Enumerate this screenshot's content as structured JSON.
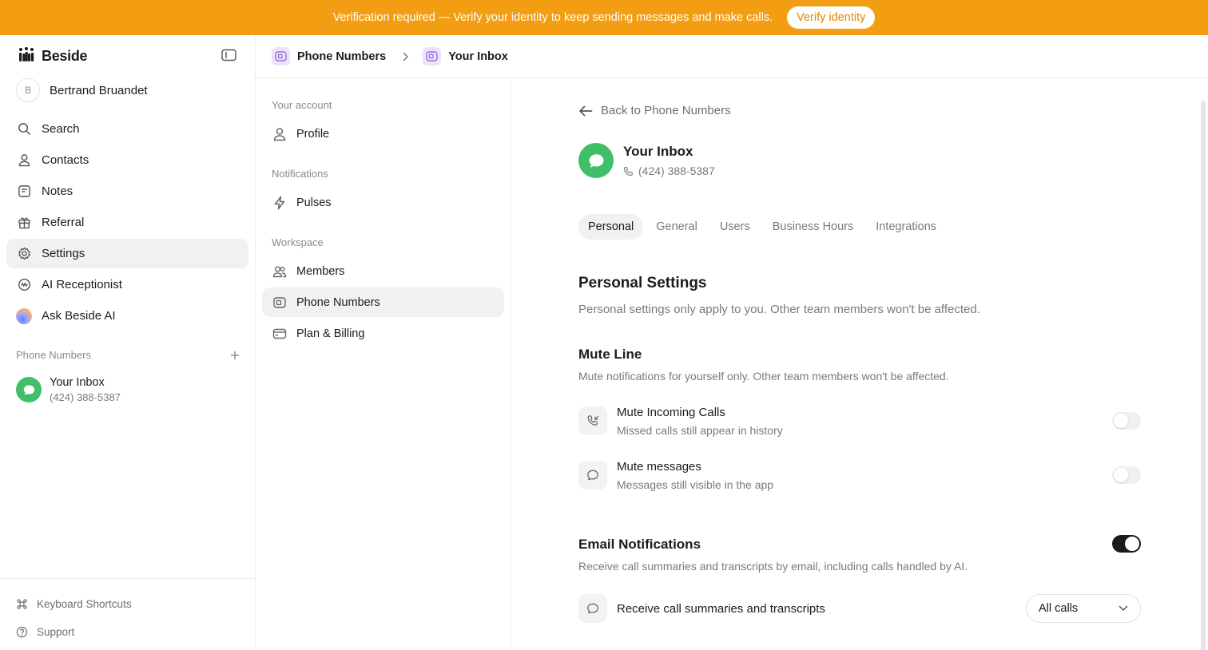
{
  "banner": {
    "text": "Verification required — Verify your identity to keep sending messages and make calls.",
    "button": "Verify identity",
    "color": "#f29d12"
  },
  "sidebar": {
    "brand": "Beside",
    "user": {
      "initial": "B",
      "name": "Bertrand Bruandet"
    },
    "nav": [
      {
        "label": "Search",
        "icon": "search-icon"
      },
      {
        "label": "Contacts",
        "icon": "person-icon"
      },
      {
        "label": "Notes",
        "icon": "note-icon"
      },
      {
        "label": "Referral",
        "icon": "gift-icon"
      },
      {
        "label": "Settings",
        "icon": "gear-icon",
        "active": true
      },
      {
        "label": "AI Receptionist",
        "icon": "ai-receptionist-icon"
      },
      {
        "label": "Ask Beside AI",
        "icon": "ai-orb-icon"
      }
    ],
    "phone_section_title": "Phone Numbers",
    "inbox": {
      "name": "Your Inbox",
      "phone": "(424) 388-5387"
    },
    "footer": [
      {
        "label": "Keyboard Shortcuts",
        "icon": "command-icon"
      },
      {
        "label": "Support",
        "icon": "help-icon"
      }
    ]
  },
  "breadcrumb": {
    "first": "Phone Numbers",
    "second": "Your Inbox"
  },
  "settings_nav": {
    "groups": [
      {
        "title": "Your account",
        "items": [
          {
            "label": "Profile",
            "icon": "person-icon"
          }
        ]
      },
      {
        "title": "Notifications",
        "items": [
          {
            "label": "Pulses",
            "icon": "bolt-icon"
          }
        ]
      },
      {
        "title": "Workspace",
        "items": [
          {
            "label": "Members",
            "icon": "people-icon"
          },
          {
            "label": "Phone Numbers",
            "icon": "phone-number-icon",
            "active": true
          },
          {
            "label": "Plan & Billing",
            "icon": "card-icon"
          }
        ]
      }
    ]
  },
  "main": {
    "back": "Back to Phone Numbers",
    "inbox_name": "Your Inbox",
    "inbox_phone": "(424) 388-5387",
    "tabs": [
      "Personal",
      "General",
      "Users",
      "Business Hours",
      "Integrations"
    ],
    "active_tab": "Personal",
    "personal": {
      "title": "Personal Settings",
      "description": "Personal settings only apply to you. Other team members won't be affected."
    },
    "mute": {
      "title": "Mute Line",
      "description": "Mute notifications for yourself only. Other team members won't be affected.",
      "calls": {
        "title": "Mute Incoming Calls",
        "subtitle": "Missed calls still appear in history",
        "enabled": false
      },
      "messages": {
        "title": "Mute messages",
        "subtitle": "Messages still visible in the app",
        "enabled": false
      }
    },
    "email": {
      "title": "Email Notifications",
      "description": "Receive call summaries and transcripts by email, including calls handled by AI.",
      "enabled": true,
      "row_label": "Receive call summaries and transcripts",
      "select_value": "All calls"
    }
  }
}
